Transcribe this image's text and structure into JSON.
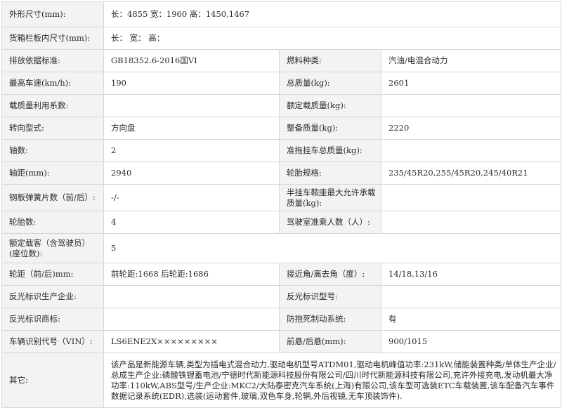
{
  "rows": [
    {
      "label": "外形尺寸(mm):",
      "value": "长：4855 宽：1960 高：1450,1467"
    },
    {
      "label": "货箱栏板内尺寸(mm):",
      "value": "长： 宽： 高："
    },
    {
      "label": "排放依据标准:",
      "value": "GB18352.6-2016国VI",
      "label2": "燃料种类:",
      "value2": "汽油/电混合动力"
    },
    {
      "label": "最高车速(km/h):",
      "value": "190",
      "label2": "总质量(kg):",
      "value2": "2601"
    },
    {
      "label": "载质量利用系数:",
      "value": "",
      "label2": "额定载质量(kg):",
      "value2": ""
    },
    {
      "label": "转向型式:",
      "value": "方向盘",
      "label2": "整备质量(kg):",
      "value2": "2220"
    },
    {
      "label": "轴数:",
      "value": "2",
      "label2": "准拖挂车总质量(kg):",
      "value2": ""
    },
    {
      "label": "轴距(mm):",
      "value": "2940",
      "label2": "轮胎规格:",
      "value2": "235/45R20,255/45R20,245/40R21"
    },
    {
      "label": "钢板弹簧片数（前/后）:",
      "value": "-/-",
      "label2": "半挂车鞍座最大允许承载质量(kg):",
      "value2": ""
    },
    {
      "label": "轮胎数:",
      "value": "4",
      "label2": "驾驶室准乘人数（人）:",
      "value2": ""
    },
    {
      "label": "额定载客（含驾驶员）(座位数):",
      "value": "5"
    },
    {
      "label": "轮距（前/后)mm:",
      "value": "前轮距:1668 后轮距:1686",
      "label2": "接近角/离去角（度）:",
      "value2": "14/18,13/16"
    },
    {
      "label": "反光标识生产企业:",
      "value": "",
      "label2": "反光标识型号:",
      "value2": ""
    },
    {
      "label": "反光标识商标:",
      "value": "",
      "label2": "防抱死制动系统:",
      "value2": "有"
    },
    {
      "label": "车辆识别代号（VIN）:",
      "value": "LS6ENE2X×××××××××",
      "label2": "前悬/后悬(mm):",
      "value2": "900/1015"
    },
    {
      "label": "其它:",
      "value": "该产品是新能源车辆,类型为插电式混合动力,驱动电机型号ATDM01,驱动电机峰值功率:231kW,储能装置种类/单体生产企业/总成生产企业:磷酸铁锂蓄电池/宁德时代新能源科技股份有限公司/四川时代新能源科技有限公司,充许外接充电,发动机最大净功率:110kW,ABS型号/生产企业:MKC2/大陆泰密克汽车系统(上海)有限公司,该车型可选装ETC车载装置,该车配备汽车事件数据记录系统(EDR),选装(运动套件,玻璃,双色车身,轮辋,外后视镜,无车顶装饰件)."
    }
  ]
}
